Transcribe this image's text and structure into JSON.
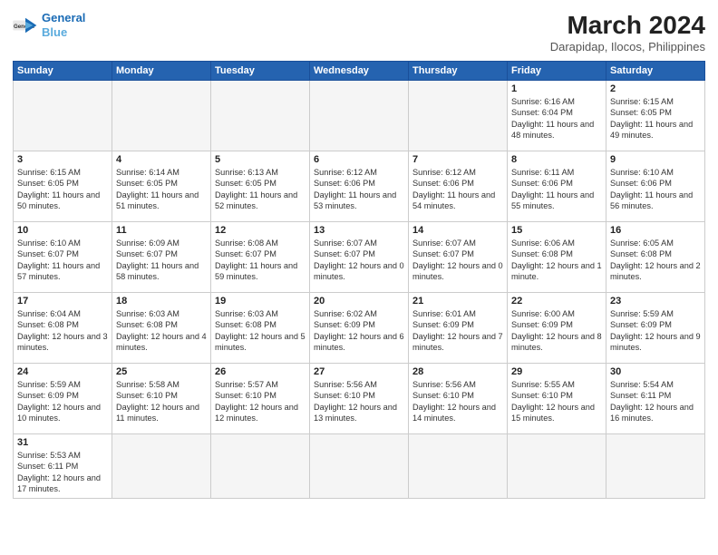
{
  "header": {
    "logo_general": "General",
    "logo_blue": "Blue",
    "title": "March 2024",
    "location": "Darapidap, Ilocos, Philippines"
  },
  "weekdays": [
    "Sunday",
    "Monday",
    "Tuesday",
    "Wednesday",
    "Thursday",
    "Friday",
    "Saturday"
  ],
  "weeks": [
    [
      {
        "day": "",
        "info": ""
      },
      {
        "day": "",
        "info": ""
      },
      {
        "day": "",
        "info": ""
      },
      {
        "day": "",
        "info": ""
      },
      {
        "day": "",
        "info": ""
      },
      {
        "day": "1",
        "info": "Sunrise: 6:16 AM\nSunset: 6:04 PM\nDaylight: 11 hours and 48 minutes."
      },
      {
        "day": "2",
        "info": "Sunrise: 6:15 AM\nSunset: 6:05 PM\nDaylight: 11 hours and 49 minutes."
      }
    ],
    [
      {
        "day": "3",
        "info": "Sunrise: 6:15 AM\nSunset: 6:05 PM\nDaylight: 11 hours and 50 minutes."
      },
      {
        "day": "4",
        "info": "Sunrise: 6:14 AM\nSunset: 6:05 PM\nDaylight: 11 hours and 51 minutes."
      },
      {
        "day": "5",
        "info": "Sunrise: 6:13 AM\nSunset: 6:05 PM\nDaylight: 11 hours and 52 minutes."
      },
      {
        "day": "6",
        "info": "Sunrise: 6:12 AM\nSunset: 6:06 PM\nDaylight: 11 hours and 53 minutes."
      },
      {
        "day": "7",
        "info": "Sunrise: 6:12 AM\nSunset: 6:06 PM\nDaylight: 11 hours and 54 minutes."
      },
      {
        "day": "8",
        "info": "Sunrise: 6:11 AM\nSunset: 6:06 PM\nDaylight: 11 hours and 55 minutes."
      },
      {
        "day": "9",
        "info": "Sunrise: 6:10 AM\nSunset: 6:06 PM\nDaylight: 11 hours and 56 minutes."
      }
    ],
    [
      {
        "day": "10",
        "info": "Sunrise: 6:10 AM\nSunset: 6:07 PM\nDaylight: 11 hours and 57 minutes."
      },
      {
        "day": "11",
        "info": "Sunrise: 6:09 AM\nSunset: 6:07 PM\nDaylight: 11 hours and 58 minutes."
      },
      {
        "day": "12",
        "info": "Sunrise: 6:08 AM\nSunset: 6:07 PM\nDaylight: 11 hours and 59 minutes."
      },
      {
        "day": "13",
        "info": "Sunrise: 6:07 AM\nSunset: 6:07 PM\nDaylight: 12 hours and 0 minutes."
      },
      {
        "day": "14",
        "info": "Sunrise: 6:07 AM\nSunset: 6:07 PM\nDaylight: 12 hours and 0 minutes."
      },
      {
        "day": "15",
        "info": "Sunrise: 6:06 AM\nSunset: 6:08 PM\nDaylight: 12 hours and 1 minute."
      },
      {
        "day": "16",
        "info": "Sunrise: 6:05 AM\nSunset: 6:08 PM\nDaylight: 12 hours and 2 minutes."
      }
    ],
    [
      {
        "day": "17",
        "info": "Sunrise: 6:04 AM\nSunset: 6:08 PM\nDaylight: 12 hours and 3 minutes."
      },
      {
        "day": "18",
        "info": "Sunrise: 6:03 AM\nSunset: 6:08 PM\nDaylight: 12 hours and 4 minutes."
      },
      {
        "day": "19",
        "info": "Sunrise: 6:03 AM\nSunset: 6:08 PM\nDaylight: 12 hours and 5 minutes."
      },
      {
        "day": "20",
        "info": "Sunrise: 6:02 AM\nSunset: 6:09 PM\nDaylight: 12 hours and 6 minutes."
      },
      {
        "day": "21",
        "info": "Sunrise: 6:01 AM\nSunset: 6:09 PM\nDaylight: 12 hours and 7 minutes."
      },
      {
        "day": "22",
        "info": "Sunrise: 6:00 AM\nSunset: 6:09 PM\nDaylight: 12 hours and 8 minutes."
      },
      {
        "day": "23",
        "info": "Sunrise: 5:59 AM\nSunset: 6:09 PM\nDaylight: 12 hours and 9 minutes."
      }
    ],
    [
      {
        "day": "24",
        "info": "Sunrise: 5:59 AM\nSunset: 6:09 PM\nDaylight: 12 hours and 10 minutes."
      },
      {
        "day": "25",
        "info": "Sunrise: 5:58 AM\nSunset: 6:10 PM\nDaylight: 12 hours and 11 minutes."
      },
      {
        "day": "26",
        "info": "Sunrise: 5:57 AM\nSunset: 6:10 PM\nDaylight: 12 hours and 12 minutes."
      },
      {
        "day": "27",
        "info": "Sunrise: 5:56 AM\nSunset: 6:10 PM\nDaylight: 12 hours and 13 minutes."
      },
      {
        "day": "28",
        "info": "Sunrise: 5:56 AM\nSunset: 6:10 PM\nDaylight: 12 hours and 14 minutes."
      },
      {
        "day": "29",
        "info": "Sunrise: 5:55 AM\nSunset: 6:10 PM\nDaylight: 12 hours and 15 minutes."
      },
      {
        "day": "30",
        "info": "Sunrise: 5:54 AM\nSunset: 6:11 PM\nDaylight: 12 hours and 16 minutes."
      }
    ],
    [
      {
        "day": "31",
        "info": "Sunrise: 5:53 AM\nSunset: 6:11 PM\nDaylight: 12 hours and 17 minutes."
      },
      {
        "day": "",
        "info": ""
      },
      {
        "day": "",
        "info": ""
      },
      {
        "day": "",
        "info": ""
      },
      {
        "day": "",
        "info": ""
      },
      {
        "day": "",
        "info": ""
      },
      {
        "day": "",
        "info": ""
      }
    ]
  ]
}
